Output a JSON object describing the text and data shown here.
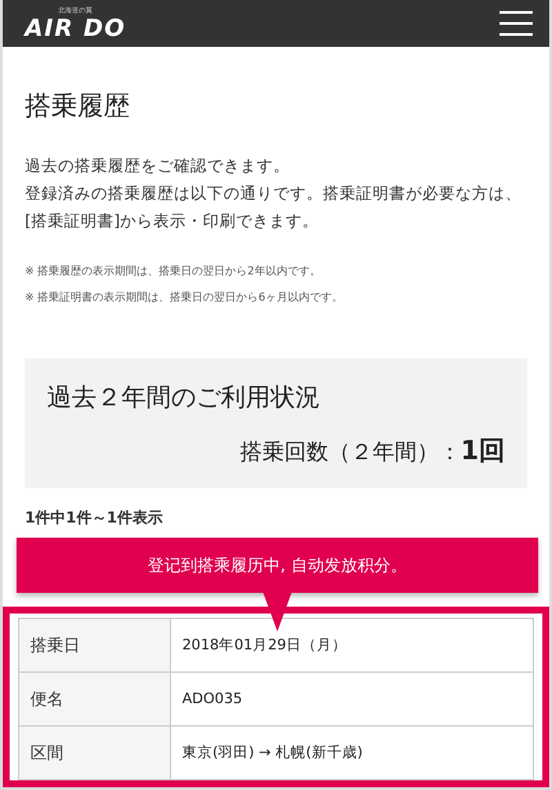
{
  "header": {
    "tagline": "北海道の翼",
    "logo": "AIR DO"
  },
  "page_title": "搭乗履歴",
  "intro": [
    "過去の搭乗履歴をご確認できます。",
    "登録済みの搭乗履歴は以下の通りです。搭乗証明書が必要な方は、[搭乗証明書]から表示・印刷できます。"
  ],
  "notes": [
    "※ 搭乗履歴の表示期間は、搭乗日の翌日から2年以内です。",
    "※ 搭乗証明書の表示期間は、搭乗日の翌日から6ヶ月以内です。"
  ],
  "summary": {
    "title": "過去２年間のご利用状況",
    "count": "搭乗回数（２年間）：**1回**"
  },
  "result_count": "1件中1件～1件表示",
  "callout": "登记到搭乘履历中, 自动发放积分。",
  "table": [
    {
      "label": "搭乗日",
      "value": "2018年01月29日（月）"
    },
    {
      "label": "便名",
      "value": "ADO035"
    },
    {
      "label": "区間",
      "value": "東京(羽田) → 札幌(新千歳)"
    }
  ]
}
